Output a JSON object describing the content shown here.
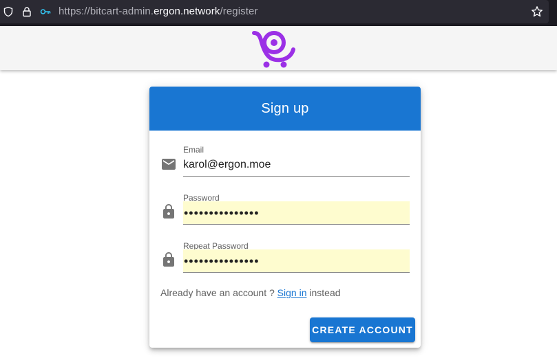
{
  "browser": {
    "url_prefix": "https://bitcart-admin.",
    "url_domain": "ergon.network",
    "url_path": "/register"
  },
  "header": {
    "logo": "bitcart-cart-logo",
    "logo_color": "#9b30e6"
  },
  "card": {
    "title": "Sign up",
    "fields": [
      {
        "label": "Email",
        "value": "karol@ergon.moe",
        "icon": "email-icon"
      },
      {
        "label": "Password",
        "value": "•••••••••••••••",
        "icon": "lock-icon"
      },
      {
        "label": "Repeat Password",
        "value": "•••••••••••••••",
        "icon": "lock-icon"
      }
    ],
    "signin_prefix": "Already have an account ? ",
    "signin_link": "Sign in",
    "signin_suffix": " instead",
    "submit_label": "CREATE ACCOUNT"
  },
  "colors": {
    "primary": "#1976d2",
    "autofill": "#fefccf"
  }
}
